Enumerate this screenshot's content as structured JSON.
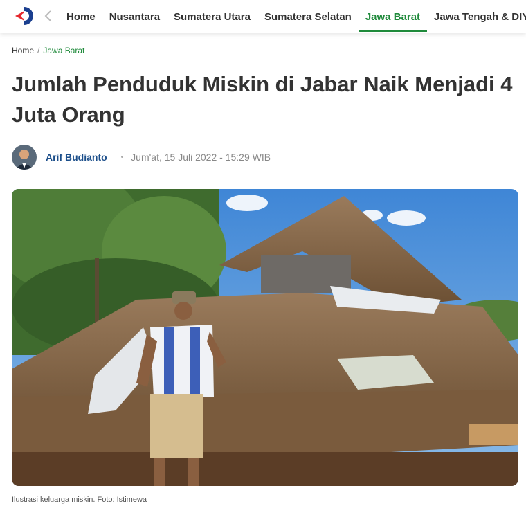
{
  "nav": {
    "items": [
      {
        "label": "Home",
        "active": false
      },
      {
        "label": "Nusantara",
        "active": false
      },
      {
        "label": "Sumatera Utara",
        "active": false
      },
      {
        "label": "Sumatera Selatan",
        "active": false
      },
      {
        "label": "Jawa Barat",
        "active": true
      },
      {
        "label": "Jawa Tengah & DIY",
        "active": false
      }
    ]
  },
  "breadcrumb": {
    "home": "Home",
    "separator": "/",
    "current": "Jawa Barat"
  },
  "article": {
    "title": "Jumlah Penduduk Miskin di Jabar Naik Menjadi 4 Juta Orang",
    "author": "Arif Budianto",
    "bullet": "•",
    "date": "Jum'at, 15 Juli 2022 - 15:29 WIB",
    "caption": "Ilustrasi keluarga miskin. Foto: Istimewa"
  },
  "colors": {
    "accent": "#1f8a3b",
    "author": "#1b4e8a",
    "logo_red": "#e5272d",
    "logo_blue": "#1b3f8f"
  }
}
